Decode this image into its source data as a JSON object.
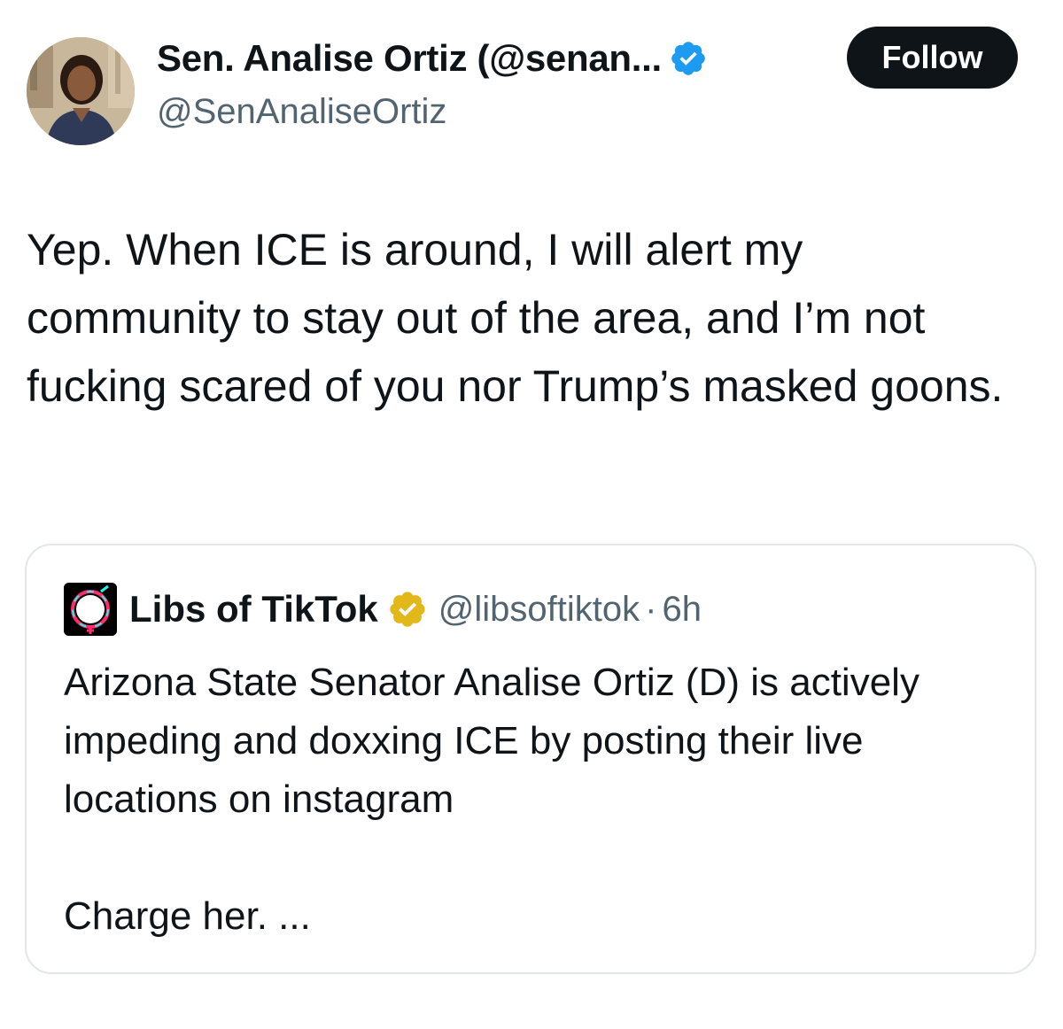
{
  "tweet": {
    "author": {
      "display_name": "Sen. Analise Ortiz (@senan...",
      "handle": "@SenAnaliseOrtiz",
      "verified": "blue-check",
      "avatar": "profile-photo"
    },
    "follow_label": "Follow",
    "text": "Yep. When ICE is around, I will alert my community to stay out of the area, and I’m not fucking scared of you nor Trump’s masked goons."
  },
  "quoted_tweet": {
    "author": {
      "display_name": "Libs of TikTok",
      "handle": "@libsoftiktok",
      "verified": "gold-check",
      "avatar_text": "Libs of TikTok"
    },
    "separator": "·",
    "time": "6h",
    "text": "Arizona State Senator Analise Ortiz (D) is actively impeding and doxxing ICE by posting their live locations on instagram",
    "text_more": "Charge her. ..."
  },
  "colors": {
    "primary_text": "#0f1419",
    "secondary_text": "#536471",
    "verified_blue": "#1d9bf0",
    "verified_gold": "#e2b719",
    "follow_bg": "#0f1419",
    "border": "#e3e7ea"
  }
}
